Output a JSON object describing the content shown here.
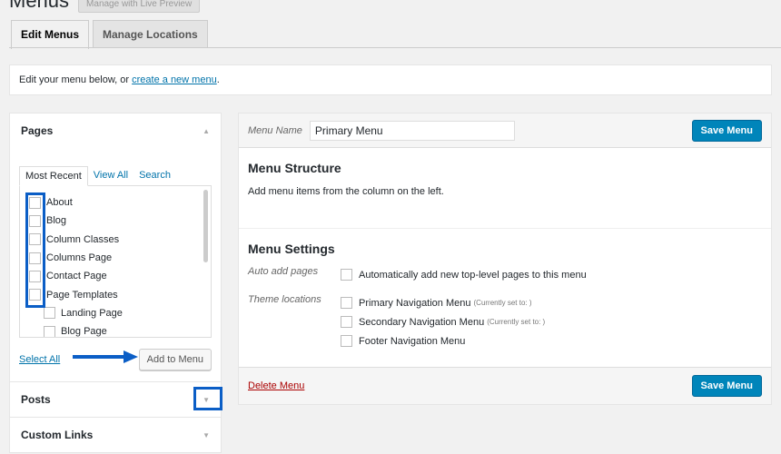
{
  "page": {
    "title": "Menus",
    "customizer_button": "Manage with Live Preview"
  },
  "tabs": [
    {
      "label": "Edit Menus",
      "active": true
    },
    {
      "label": "Manage Locations",
      "active": false
    }
  ],
  "notice": {
    "text": "Edit your menu below, or",
    "link": "create a new menu",
    "suffix": "."
  },
  "sidebar": {
    "pages": {
      "title": "Pages",
      "tabs": [
        "Most Recent",
        "View All",
        "Search"
      ],
      "items": [
        {
          "label": "About",
          "child": false
        },
        {
          "label": "Blog",
          "child": false
        },
        {
          "label": "Column Classes",
          "child": false
        },
        {
          "label": "Columns Page",
          "child": false
        },
        {
          "label": "Contact Page",
          "child": false
        },
        {
          "label": "Page Templates",
          "child": false
        },
        {
          "label": "Landing Page",
          "child": true
        },
        {
          "label": "Blog Page",
          "child": true
        }
      ],
      "select_all": "Select All",
      "add_button": "Add to Menu"
    },
    "posts": {
      "title": "Posts"
    },
    "custom_links": {
      "title": "Custom Links"
    }
  },
  "menu": {
    "name_label": "Menu Name",
    "name_value": "Primary Menu",
    "save_label": "Save Menu",
    "structure_title": "Menu Structure",
    "structure_text": "Add menu items from the column on the left.",
    "settings_title": "Menu Settings",
    "auto_add_label": "Auto add pages",
    "auto_add_option": "Automatically add new top-level pages to this menu",
    "theme_locations_label": "Theme locations",
    "locations": [
      {
        "label": "Primary Navigation Menu",
        "note": "(Currently set to: )"
      },
      {
        "label": "Secondary Navigation Menu",
        "note": "(Currently set to: )"
      },
      {
        "label": "Footer Navigation Menu",
        "note": ""
      }
    ],
    "delete_label": "Delete Menu"
  },
  "colors": {
    "accent_blue": "#0085ba",
    "highlight_blue": "#0b5ec6",
    "delete_red": "#aa0000",
    "link_blue": "#0073aa"
  },
  "icons": {
    "collapse_up": "triangle-up-icon",
    "expand_down": "triangle-down-icon",
    "annotation_arrow": "arrow-right-icon"
  }
}
